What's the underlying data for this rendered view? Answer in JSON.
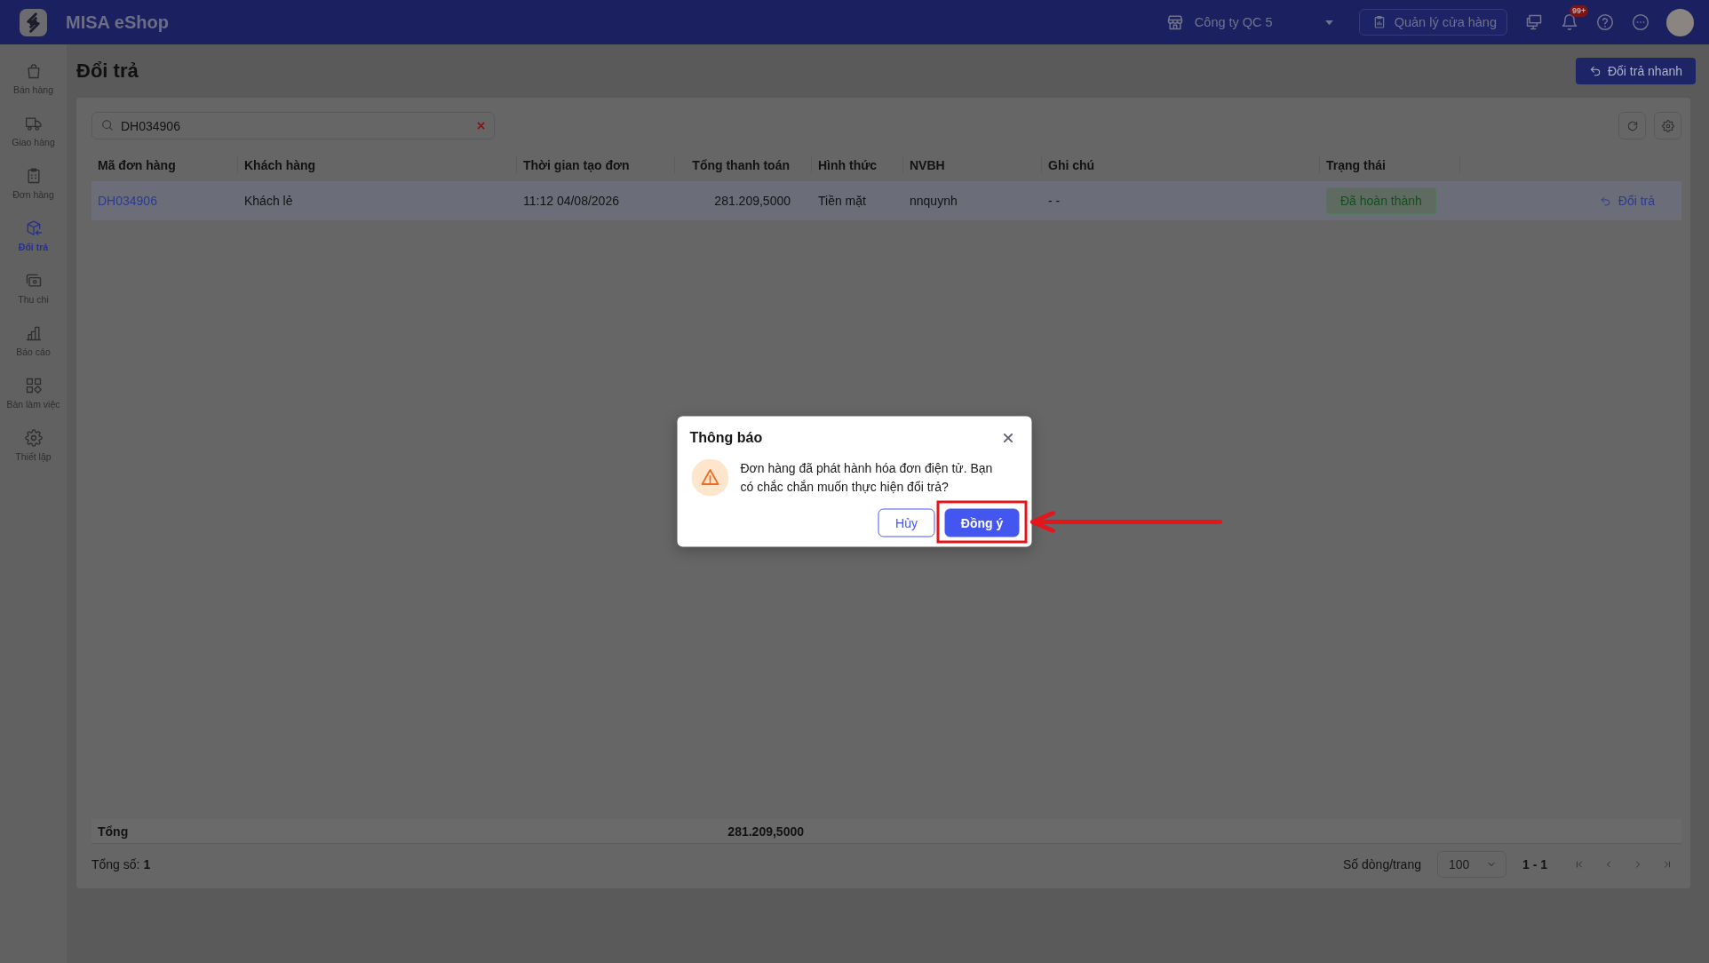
{
  "header": {
    "app_name": "MISA eShop",
    "company": "Công ty QC 5",
    "store_button": "Quản lý cửa hàng",
    "notification_count": "99+"
  },
  "sidebar": {
    "items": [
      {
        "label": "Bán hàng",
        "selected": false
      },
      {
        "label": "Giao hàng",
        "selected": false
      },
      {
        "label": "Đơn hàng",
        "selected": false
      },
      {
        "label": "Đổi trả",
        "selected": true
      },
      {
        "label": "Thu chi",
        "selected": false
      },
      {
        "label": "Báo cáo",
        "selected": false
      },
      {
        "label": "Bàn làm việc",
        "selected": false
      },
      {
        "label": "Thiết lập",
        "selected": false
      }
    ]
  },
  "page": {
    "title": "Đổi trả",
    "quick_button": "Đổi trả nhanh"
  },
  "search": {
    "value": "DH034906"
  },
  "table": {
    "columns": [
      "Mã đơn hàng",
      "Khách hàng",
      "Thời gian tạo đơn",
      "Tổng thanh toán",
      "Hình thức",
      "NVBH",
      "Ghi chú",
      "Trạng thái"
    ],
    "rows": [
      {
        "selected": true,
        "order_id": "DH034906",
        "customer": "Khách lẻ",
        "created_at": "11:12 04/08/2026",
        "total": "281.209,5000",
        "payment": "Tiền mặt",
        "staff": "nnquynh",
        "note": "- -",
        "status": "Đã hoàn thành",
        "action": "Đổi trả"
      }
    ]
  },
  "summary": {
    "label": "Tổng",
    "total": "281.209,5000"
  },
  "pagination": {
    "count": "Tổng số: **1**",
    "rows_per_page_label": "Số dòng/trang",
    "rows_per_page": "100",
    "range": "1 - 1"
  },
  "dialog": {
    "title": "Thông báo",
    "message": "Đơn hàng đã phát hành hóa đơn điện tử. Bạn có chắc chắn muốn thực hiện đổi trả?",
    "buttons": [
      {
        "label": "Hủy",
        "kind": "secondary",
        "highlighted": false
      },
      {
        "label": "Đồng ý",
        "kind": "primary",
        "highlighted": true
      }
    ]
  }
}
